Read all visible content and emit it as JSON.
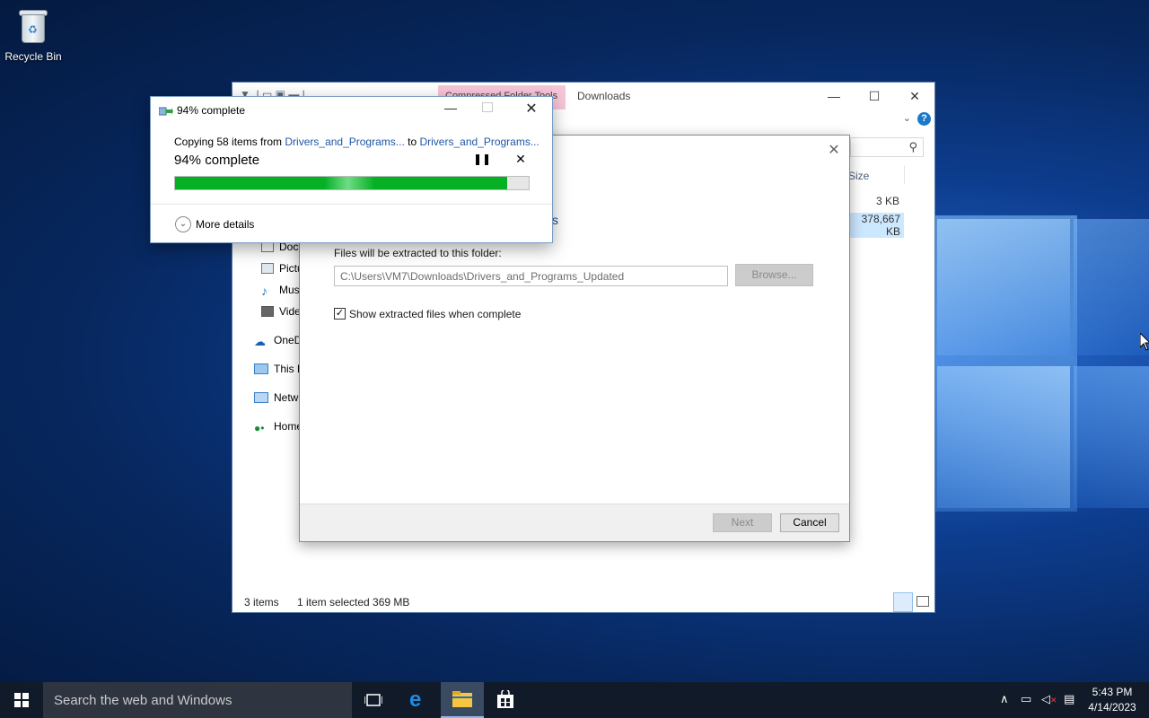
{
  "desktop": {
    "recycle_bin_label": "Recycle Bin"
  },
  "explorer": {
    "title": "Downloads",
    "context_tab": "Compressed Folder Tools",
    "column_header_size": "Size",
    "rows": [
      {
        "size": "3 KB"
      },
      {
        "size": "378,667 KB",
        "selected": true
      }
    ],
    "nav_items": [
      "Documents",
      "Pictures",
      "Music",
      "Videos",
      "OneDrive",
      "This PC",
      "Network",
      "Homegroup"
    ],
    "status_items": "3 items",
    "status_selected": "1 item selected  369 MB"
  },
  "wizard": {
    "partial_title": "s",
    "folder_label": "Files will be extracted to this folder:",
    "path_value": "C:\\Users\\VM7\\Downloads\\Drivers_and_Programs_Updated",
    "browse_label": "Browse...",
    "show_files_label": "Show extracted files when complete",
    "show_files_checked": true,
    "next_label": "Next",
    "cancel_label": "Cancel"
  },
  "copy_dialog": {
    "title": "94% complete",
    "copying_prefix": "Copying 58 items from ",
    "source": "Drivers_and_Programs...",
    "to_word": " to ",
    "destination": "Drivers_and_Programs...",
    "percent_text": "94% complete",
    "progress": 0.94,
    "more_details": "More details"
  },
  "taskbar": {
    "search_placeholder": "Search the web and Windows",
    "time": "5:43 PM",
    "date": "4/14/2023"
  },
  "colors": {
    "progress_green": "#06b025",
    "link_blue": "#1d57a8",
    "taskbar_bg": "#101a28"
  }
}
